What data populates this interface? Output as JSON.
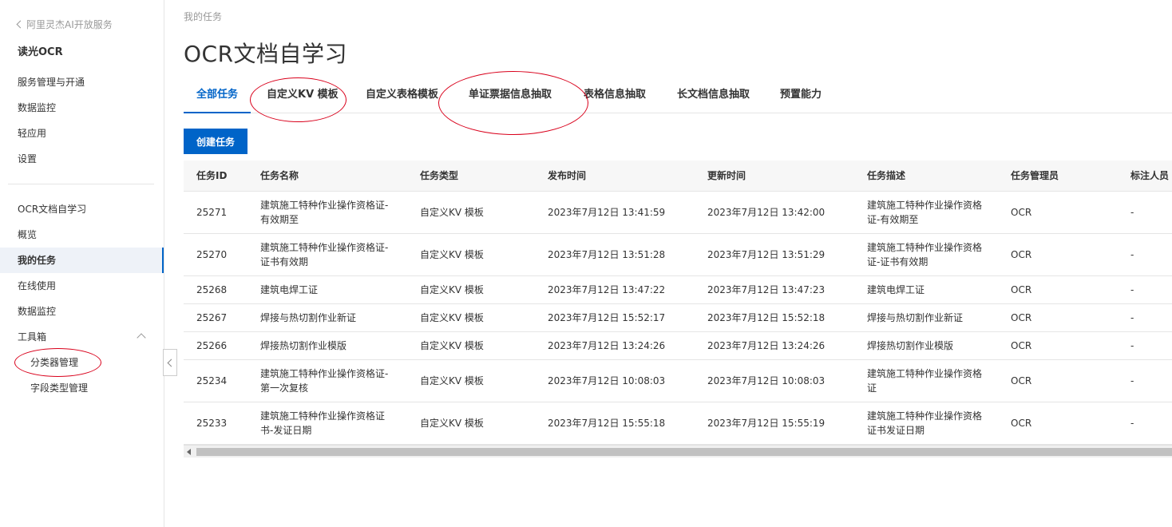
{
  "sidebar": {
    "back_label": "阿里灵杰AI开放服务",
    "product": "读光OCR",
    "items": [
      {
        "label": "服务管理与开通"
      },
      {
        "label": "数据监控"
      },
      {
        "label": "轻应用"
      },
      {
        "label": "设置"
      },
      {
        "label": "OCR文档自学习"
      },
      {
        "label": "概览"
      },
      {
        "label": "我的任务"
      },
      {
        "label": "在线使用"
      },
      {
        "label": "数据监控"
      },
      {
        "label": "工具箱"
      },
      {
        "label": "分类器管理"
      },
      {
        "label": "字段类型管理"
      }
    ]
  },
  "breadcrumb": "我的任务",
  "page_title": "OCR文档自学习",
  "tabs": [
    "全部任务",
    "自定义KV 模板",
    "自定义表格模板",
    "单证票据信息抽取",
    "表格信息抽取",
    "长文档信息抽取",
    "预置能力"
  ],
  "create_button": "创建任务",
  "table": {
    "headers": [
      "任务ID",
      "任务名称",
      "任务类型",
      "发布时间",
      "更新时间",
      "任务描述",
      "任务管理员",
      "标注人员"
    ],
    "rows": [
      {
        "id": "25271",
        "name": [
          "建筑施工特种作业操作资格证-",
          "有效期至"
        ],
        "type": "自定义KV 模板",
        "published": "2023年7月12日 13:41:59",
        "updated": "2023年7月12日 13:42:00",
        "desc": [
          "建筑施工特种作业操作资格",
          "证-有效期至"
        ],
        "admin": "OCR",
        "labeler": "-"
      },
      {
        "id": "25270",
        "name": [
          "建筑施工特种作业操作资格证-",
          "证书有效期"
        ],
        "type": "自定义KV 模板",
        "published": "2023年7月12日 13:51:28",
        "updated": "2023年7月12日 13:51:29",
        "desc": [
          "建筑施工特种作业操作资格",
          "证-证书有效期"
        ],
        "admin": "OCR",
        "labeler": "-"
      },
      {
        "id": "25268",
        "name": [
          "建筑电焊工证"
        ],
        "type": "自定义KV 模板",
        "published": "2023年7月12日 13:47:22",
        "updated": "2023年7月12日 13:47:23",
        "desc": [
          "建筑电焊工证"
        ],
        "admin": "OCR",
        "labeler": "-"
      },
      {
        "id": "25267",
        "name": [
          "焊接与热切割作业新证"
        ],
        "type": "自定义KV 模板",
        "published": "2023年7月12日 15:52:17",
        "updated": "2023年7月12日 15:52:18",
        "desc": [
          "焊接与热切割作业新证"
        ],
        "admin": "OCR",
        "labeler": "-"
      },
      {
        "id": "25266",
        "name": [
          "焊接热切割作业模版"
        ],
        "type": "自定义KV 模板",
        "published": "2023年7月12日 13:24:26",
        "updated": "2023年7月12日 13:24:26",
        "desc": [
          "焊接热切割作业模版"
        ],
        "admin": "OCR",
        "labeler": "-"
      },
      {
        "id": "25234",
        "name": [
          "建筑施工特种作业操作资格证-",
          "第一次复核"
        ],
        "type": "自定义KV 模板",
        "published": "2023年7月12日 10:08:03",
        "updated": "2023年7月12日 10:08:03",
        "desc": [
          "建筑施工特种作业操作资格",
          "证"
        ],
        "admin": "OCR",
        "labeler": "-"
      },
      {
        "id": "25233",
        "name": [
          "建筑施工特种作业操作资格证",
          "书-发证日期"
        ],
        "type": "自定义KV 模板",
        "published": "2023年7月12日 15:55:18",
        "updated": "2023年7月12日 15:55:19",
        "desc": [
          "建筑施工特种作业操作资格",
          "证书发证日期"
        ],
        "admin": "OCR",
        "labeler": "-"
      }
    ]
  },
  "colors": {
    "accent": "#0064c8",
    "annotation": "#d9001b"
  }
}
